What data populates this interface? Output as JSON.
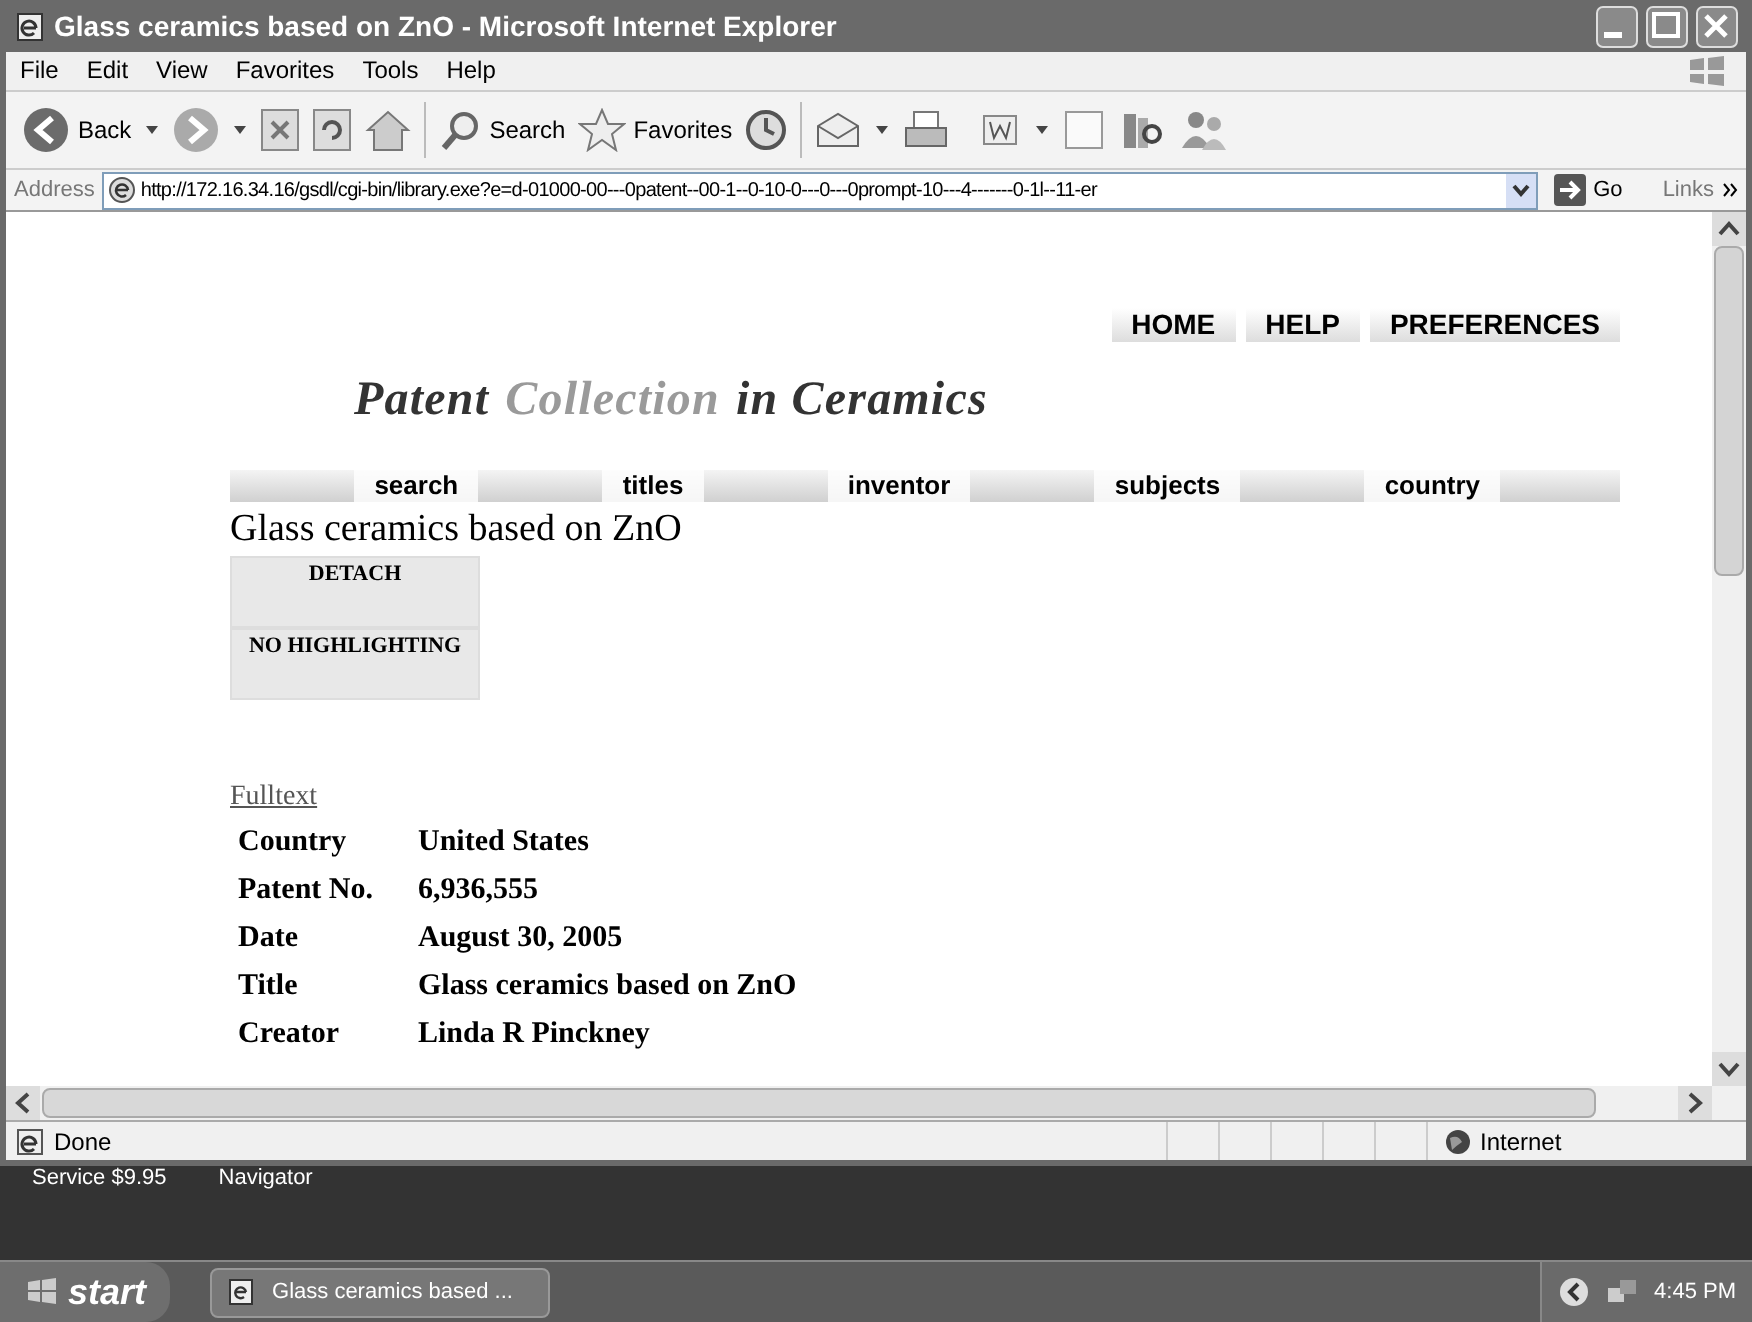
{
  "window": {
    "title": "Glass ceramics based on ZnO - Microsoft Internet Explorer"
  },
  "menu": [
    "File",
    "Edit",
    "View",
    "Favorites",
    "Tools",
    "Help"
  ],
  "toolbar": {
    "back": "Back",
    "search": "Search",
    "favorites": "Favorites"
  },
  "address": {
    "label": "Address",
    "url": "http://172.16.34.16/gsdl/cgi-bin/library.exe?e=d-01000-00---0patent--00-1--0-10-0---0---0prompt-10---4-------0-1l--11-er",
    "go": "Go",
    "links": "Links"
  },
  "top_links": [
    "HOME",
    "HELP",
    "PREFERENCES"
  ],
  "logo": [
    {
      "text": "Patent",
      "highlighted": false
    },
    {
      "text": "Collection",
      "highlighted": true
    },
    {
      "text": "in Ceramics",
      "highlighted": false
    }
  ],
  "nav": [
    "search",
    "titles",
    "inventor",
    "subjects",
    "country"
  ],
  "heading": "Glass ceramics based on ZnO",
  "actions": [
    "DETACH",
    "NO HIGHLIGHTING"
  ],
  "fulltext": "Fulltext",
  "fields": [
    {
      "label": "Country",
      "value": "United States"
    },
    {
      "label": "Patent No.",
      "value": "6,936,555"
    },
    {
      "label": "Date",
      "value": "August 30, 2005"
    },
    {
      "label": "Title",
      "value": "Glass ceramics based on ZnO"
    },
    {
      "label": "Creator",
      "value": "Linda R Pinckney"
    }
  ],
  "status_bar": {
    "text": "Done",
    "zone": "Internet"
  },
  "desktop": [
    "Service $9.95",
    "Navigator"
  ],
  "taskbar": {
    "start": "start",
    "task": "Glass ceramics based ...",
    "clock": "4:45 PM"
  }
}
